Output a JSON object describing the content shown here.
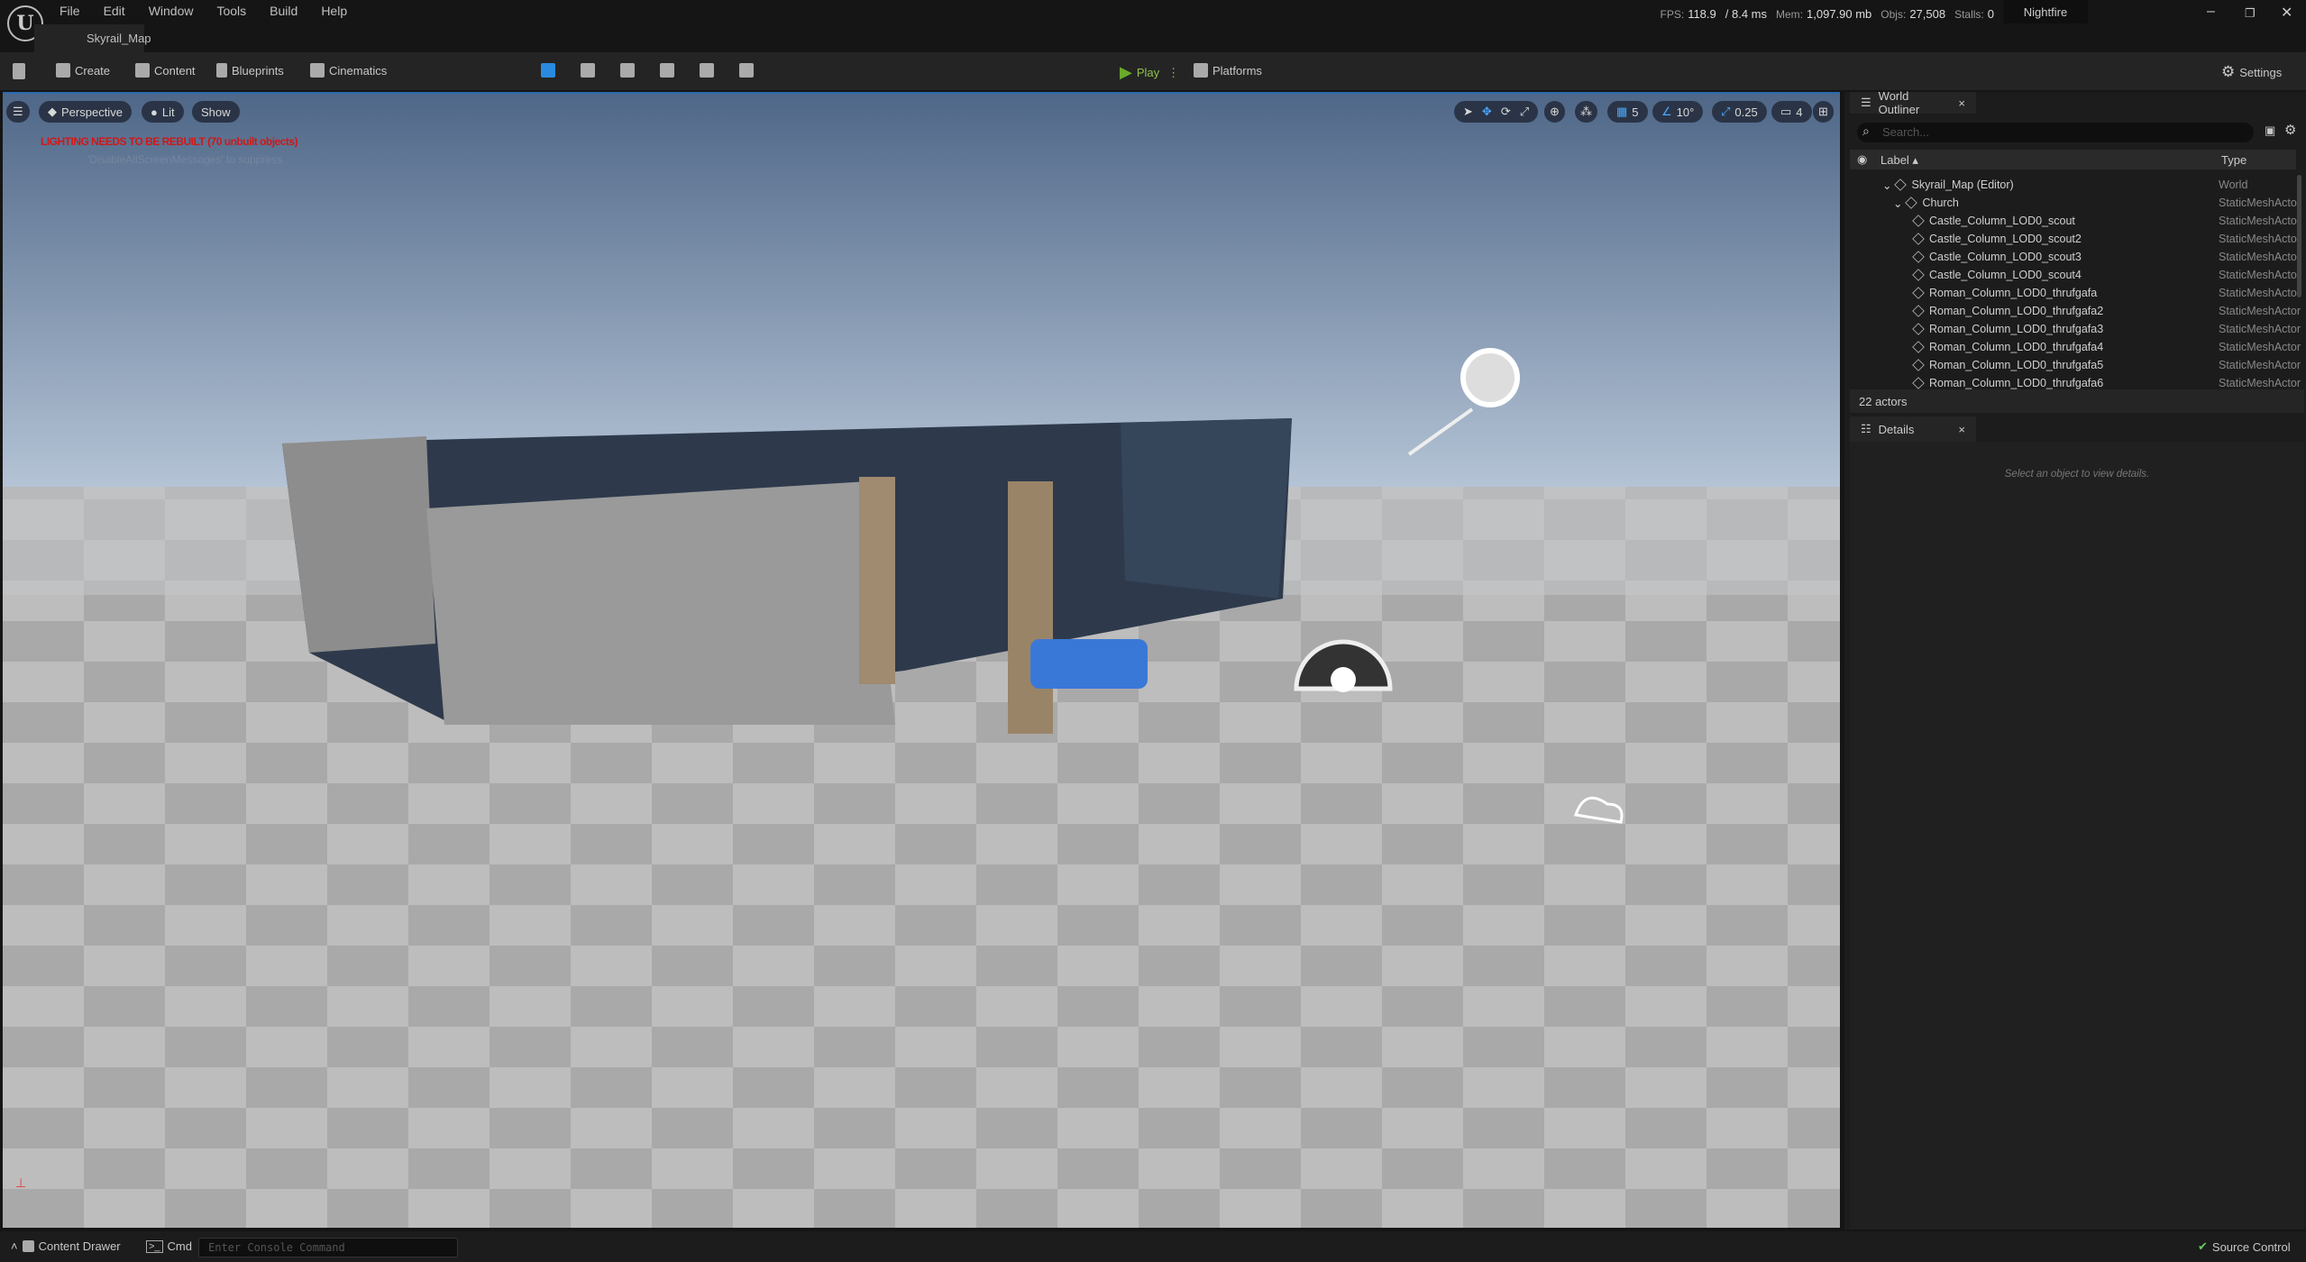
{
  "menu": [
    "File",
    "Edit",
    "Window",
    "Tools",
    "Build",
    "Help"
  ],
  "map_tab": "Skyrail_Map",
  "stats": {
    "fps_label": "FPS:",
    "fps": "118.9",
    "ms": "/ 8.4 ms",
    "mem_label": "Mem:",
    "mem": "1,097.90 mb",
    "objs_label": "Objs:",
    "objs": "27,508",
    "stalls_label": "Stalls:",
    "stalls": "0"
  },
  "project": "Nightfire",
  "toolbar": {
    "create": "Create",
    "content": "Content",
    "blueprints": "Blueprints",
    "cinematics": "Cinematics",
    "play": "Play",
    "platforms": "Platforms",
    "settings": "Settings"
  },
  "viewport": {
    "perspective": "Perspective",
    "lit": "Lit",
    "show": "Show",
    "grid": "5",
    "angle": "10°",
    "scale": "0.25",
    "camera_speed": "4",
    "warning": "LIGHTING NEEDS TO BE REBUILT (70 unbuilt objects)",
    "warning_sub": "'DisableAllScreenMessages' to suppress",
    "accent": "#2a6ab0"
  },
  "outliner": {
    "title": "World Outliner",
    "search_placeholder": "Search...",
    "col_label": "Label",
    "col_type": "Type",
    "rows": [
      {
        "label": "Skyrail_Map (Editor)",
        "type": "World",
        "depth": 0
      },
      {
        "label": "Church",
        "type": "StaticMeshActor",
        "depth": 1
      },
      {
        "label": "Castle_Column_LOD0_scout",
        "type": "StaticMeshActor",
        "depth": 2
      },
      {
        "label": "Castle_Column_LOD0_scout2",
        "type": "StaticMeshActor",
        "depth": 2
      },
      {
        "label": "Castle_Column_LOD0_scout3",
        "type": "StaticMeshActor",
        "depth": 2
      },
      {
        "label": "Castle_Column_LOD0_scout4",
        "type": "StaticMeshActor",
        "depth": 2
      },
      {
        "label": "Roman_Column_LOD0_thrufgafa",
        "type": "StaticMeshActor",
        "depth": 2
      },
      {
        "label": "Roman_Column_LOD0_thrufgafa2",
        "type": "StaticMeshActor",
        "depth": 2
      },
      {
        "label": "Roman_Column_LOD0_thrufgafa3",
        "type": "StaticMeshActor",
        "depth": 2
      },
      {
        "label": "Roman_Column_LOD0_thrufgafa4",
        "type": "StaticMeshActor",
        "depth": 2
      },
      {
        "label": "Roman_Column_LOD0_thrufgafa5",
        "type": "StaticMeshActor",
        "depth": 2
      },
      {
        "label": "Roman_Column_LOD0_thrufgafa6",
        "type": "StaticMeshActor",
        "depth": 2
      }
    ],
    "count": "22 actors"
  },
  "details": {
    "title": "Details",
    "empty": "Select an object to view details."
  },
  "status": {
    "content_drawer": "Content Drawer",
    "cmd": "Cmd",
    "console_placeholder": "Enter Console Command",
    "source_control": "Source Control"
  }
}
